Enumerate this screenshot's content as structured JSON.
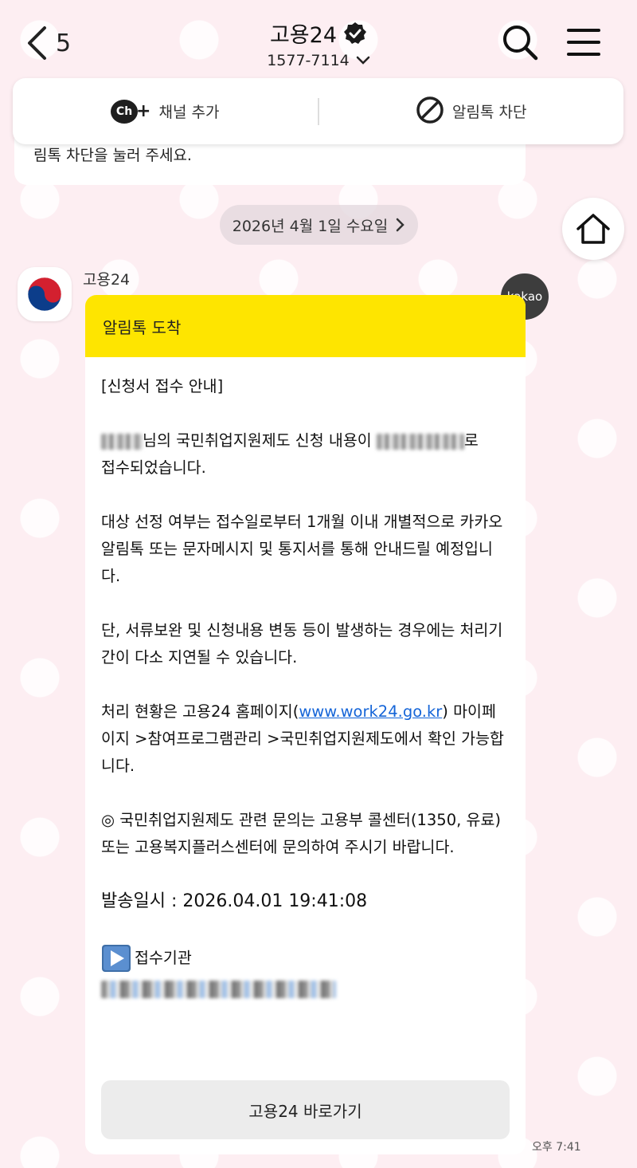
{
  "header": {
    "back_count": "5",
    "channel_name": "고용24",
    "phone": "1577-7114"
  },
  "actions": {
    "add_channel_label": "채널 추가",
    "add_channel_icon_text": "Ch",
    "block_label": "알림톡 차단"
  },
  "prev_message": {
    "text_tail": "림톡 차단을 눌러 주세요."
  },
  "date_divider": "2026년 4월 1일 수요일",
  "sender_name": "고용24",
  "kakao_badge": "kakao",
  "message": {
    "header": "알림톡 도착",
    "title": "[신청서 접수 안내]",
    "line_accept_a": "님의 국민취업지원제도 신청 내용이",
    "line_accept_b": "로",
    "line_accept_c": "접수되었습니다.",
    "para_selection": "대상 선정 여부는 접수일로부터 1개월 이내 개별적으로 카카오알림톡 또는 문자메시지 및 통지서를 통해 안내드릴 예정입니다.",
    "para_delay": "단, 서류보완 및 신청내용 변동 등이 발생하는 경우에는 처리기간이 다소 지연될 수 있습니다.",
    "status_prefix": "처리 현황은 고용24 홈페이지(",
    "status_link": "www.work24.go.kr",
    "status_suffix": ") 마이페이지 >참여프로그램관리 >국민취업지원제도에서 확인 가능합니다.",
    "para_inquiry": "◎ 국민취업지원제도 관련 문의는 고용부 콜센터(1350, 유료) 또는 고용복지플러스센터에 문의하여 주시기 바랍니다.",
    "sent_time": "발송일시 : 2026.04.01 19:41:08",
    "agency_label": "접수기관",
    "button_label": "고용24 바로가기"
  },
  "timestamp": "오후 7:41",
  "colors": {
    "background": "#fdeef2",
    "card_header": "#fee500",
    "link": "#1565d8",
    "badge": "#3d3d3d"
  }
}
